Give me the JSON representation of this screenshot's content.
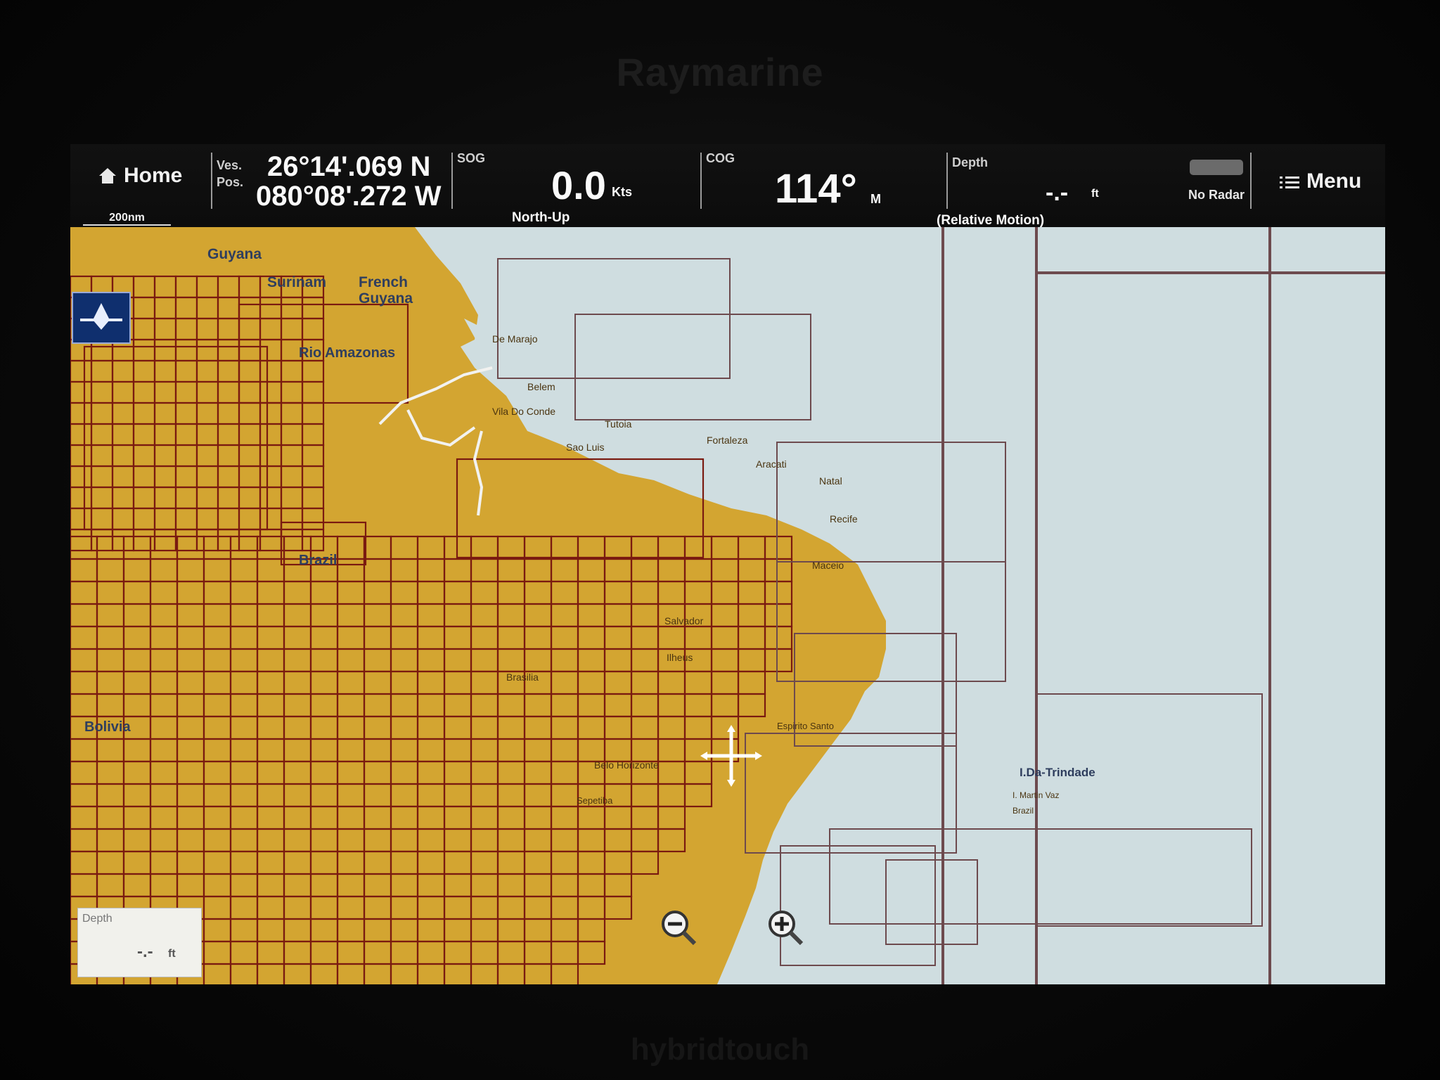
{
  "device": {
    "brand": "Raymarine",
    "model": "hybridtouch"
  },
  "topbar": {
    "home_label": "Home",
    "scale_label": "200nm",
    "vessel_label_line1": "Ves.",
    "vessel_label_line2": "Pos.",
    "latitude": "26°14'.069 N",
    "longitude": "080°08'.272 W",
    "sog_label": "SOG",
    "sog_value": "0.0",
    "sog_unit": "Kts",
    "orientation": "North-Up",
    "cog_label": "COG",
    "cog_value": "114°",
    "cog_unit": "M",
    "depth_label": "Depth",
    "depth_value": "-.-",
    "depth_unit": "ft",
    "motion_mode": "(Relative Motion)",
    "radar_status": "No Radar",
    "menu_label": "Menu"
  },
  "map": {
    "place_labels": [
      "Guyana",
      "Surinam",
      "French\nGuyana",
      "Rio Amazonas",
      "De Marajo",
      "Belem",
      "Vila Do Conde",
      "Tutoia",
      "Sao Luis",
      "Fortaleza",
      "Aracati",
      "Natal",
      "Recife",
      "Maceio",
      "Brazil",
      "Salvador",
      "Ilheus",
      "Brasilia",
      "Bolivia",
      "Belo Horizonte",
      "Espirito Santo",
      "I.Da-Trindade",
      "I. Martin Vaz",
      "Brazil",
      "Sepetiba"
    ],
    "depth_panel_label": "Depth",
    "depth_panel_value": "-.-",
    "depth_panel_unit": "ft",
    "colors": {
      "land": "#d3a531",
      "sea": "#cfdde0",
      "chart_border": "#7a1a10",
      "offshore_border": "#6d4a4e"
    }
  }
}
